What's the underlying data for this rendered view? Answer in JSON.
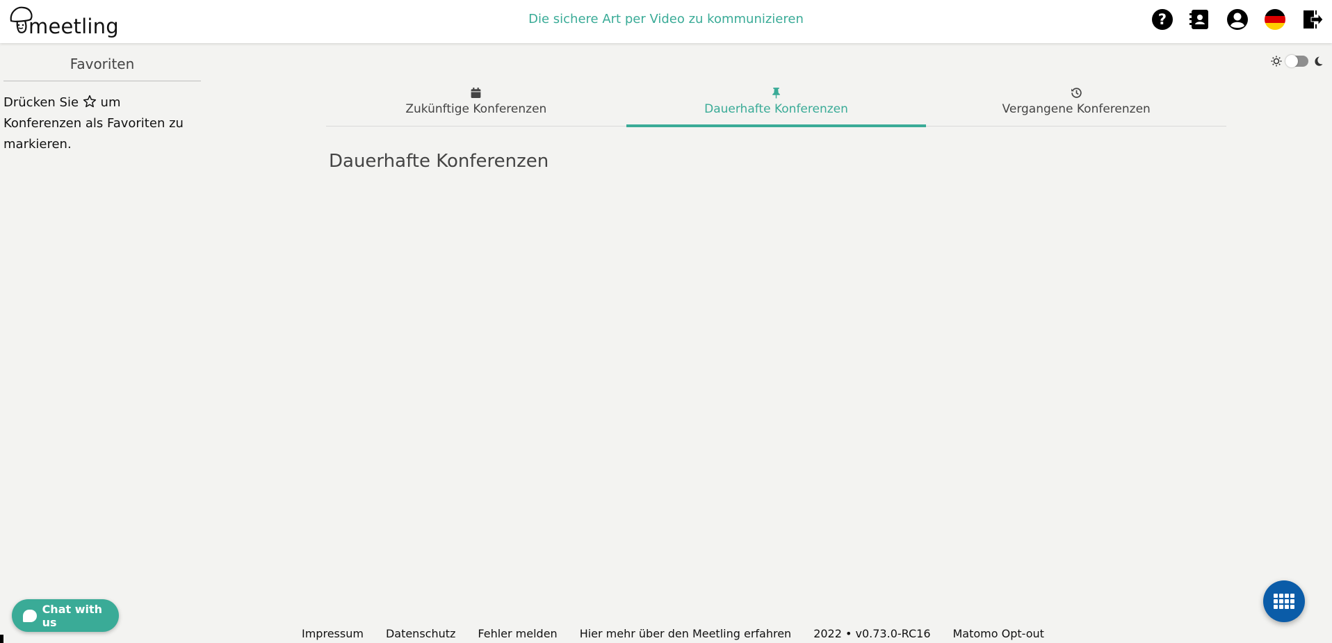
{
  "header": {
    "logo_text": "meetling",
    "tagline": "Die sichere Art per Video zu kommunizieren",
    "icons": [
      "help-icon",
      "address-book-icon",
      "user-account-icon",
      "german-flag-icon",
      "logout-icon"
    ]
  },
  "sidebar": {
    "title": "Favoriten",
    "hint_before": "Drücken Sie",
    "hint_after": "um Konferenzen als Favoriten zu markieren."
  },
  "theme": {
    "mode": "light",
    "icons": [
      "sun-icon",
      "moon-icon"
    ]
  },
  "tabs": [
    {
      "label": "Zukünftige Konferenzen",
      "icon": "calendar-icon",
      "active": false
    },
    {
      "label": "Dauerhafte Konferenzen",
      "icon": "pin-icon",
      "active": true
    },
    {
      "label": "Vergangene Konferenzen",
      "icon": "history-icon",
      "active": false
    }
  ],
  "main": {
    "heading": "Dauerhafte Konferenzen"
  },
  "chat": {
    "label": "Chat with us"
  },
  "footer": {
    "links": [
      "Impressum",
      "Datenschutz",
      "Fehler melden",
      "Hier mehr über den Meetling erfahren",
      "2022 • v0.73.0-RC16",
      "Matomo Opt-out"
    ]
  },
  "colors": {
    "accent": "#3aab97",
    "background": "#f3f3f1",
    "grid_button": "#0b5ca8"
  }
}
